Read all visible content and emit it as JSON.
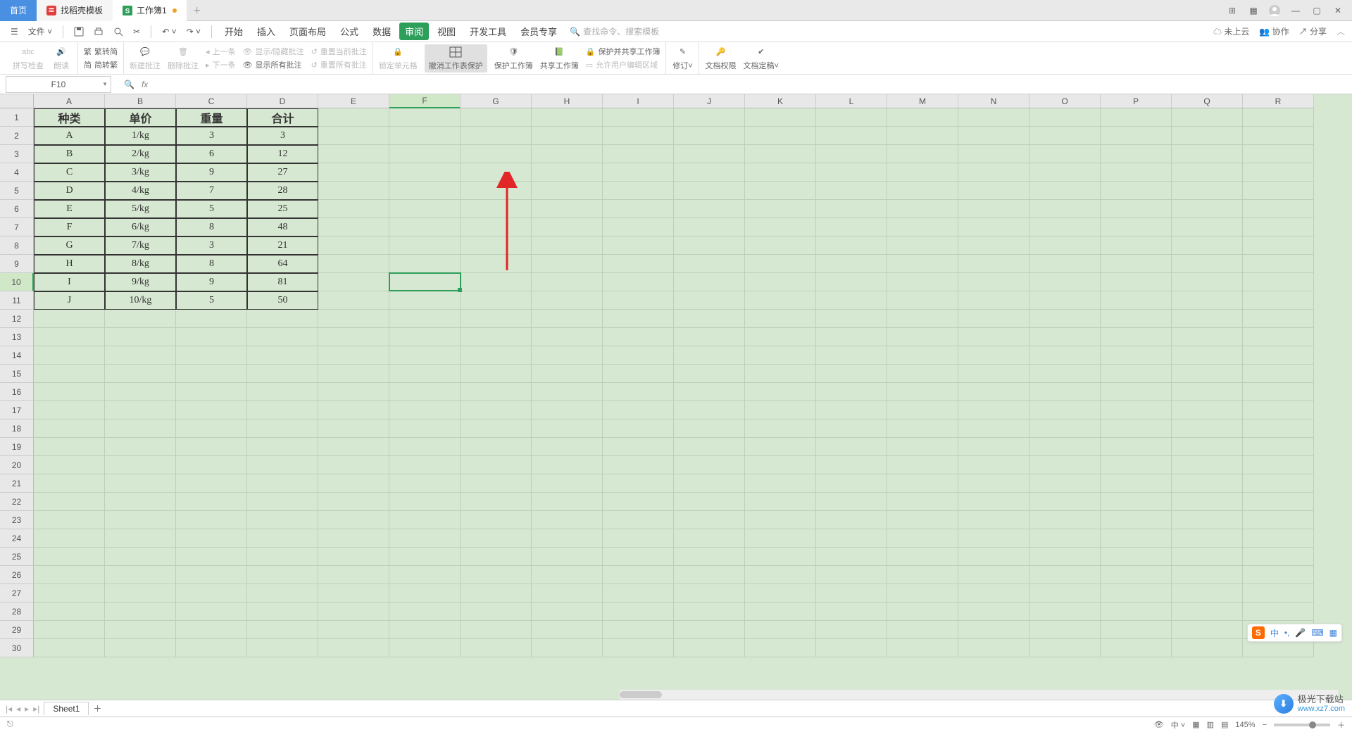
{
  "tabs": {
    "home": "首页",
    "tpl": "找稻壳模板",
    "wb": "工作簿1"
  },
  "win": {
    "layout1": "⊞",
    "layout2": "▦"
  },
  "menu": {
    "file": "文件",
    "items": [
      "开始",
      "插入",
      "页面布局",
      "公式",
      "数据",
      "审阅",
      "视图",
      "开发工具",
      "会员专享"
    ],
    "active_idx": 5,
    "search_hint": "查找命令、搜索模板"
  },
  "menu_right": {
    "cloud": "未上云",
    "collab": "协作",
    "share": "分享"
  },
  "ribbon": {
    "spell": "拼写检查",
    "read": "朗读",
    "t1": "繁转简",
    "t2": "简转繁",
    "newc": "新建批注",
    "delc": "删除批注",
    "prev": "上一条",
    "next": "下一条",
    "sh": "显示/隐藏批注",
    "sa": "显示所有批注",
    "rc": "重置当前批注",
    "ra": "重置所有批注",
    "lock": "锁定单元格",
    "unprotect": "撤消工作表保护",
    "protwb": "保护工作簿",
    "sharewb": "共享工作簿",
    "protshare": "保护并共享工作簿",
    "allow": "允许用户编辑区域",
    "track": "修订",
    "perm": "文档权限",
    "final": "文档定稿"
  },
  "namebox": "F10",
  "cols": [
    "A",
    "B",
    "C",
    "D",
    "E",
    "F",
    "G",
    "H",
    "I",
    "J",
    "K",
    "L",
    "M",
    "N",
    "O",
    "P",
    "Q",
    "R"
  ],
  "rows": 30,
  "sel": {
    "col": 5,
    "row": 9
  },
  "table": {
    "headers": [
      "种类",
      "单价",
      "重量",
      "合计"
    ],
    "rows": [
      [
        "A",
        "1/kg",
        "3",
        "3"
      ],
      [
        "B",
        "2/kg",
        "6",
        "12"
      ],
      [
        "C",
        "3/kg",
        "9",
        "27"
      ],
      [
        "D",
        "4/kg",
        "7",
        "28"
      ],
      [
        "E",
        "5/kg",
        "5",
        "25"
      ],
      [
        "F",
        "6/kg",
        "8",
        "48"
      ],
      [
        "G",
        "7/kg",
        "3",
        "21"
      ],
      [
        "H",
        "8/kg",
        "8",
        "64"
      ],
      [
        "I",
        "9/kg",
        "9",
        "81"
      ],
      [
        "J",
        "10/kg",
        "5",
        "50"
      ]
    ]
  },
  "sheet_tab": "Sheet1",
  "status": {
    "zoom": "145%"
  },
  "ime": {
    "ch": "中"
  },
  "wm": {
    "text": "极光下载站",
    "url": "www.xz7.com"
  }
}
